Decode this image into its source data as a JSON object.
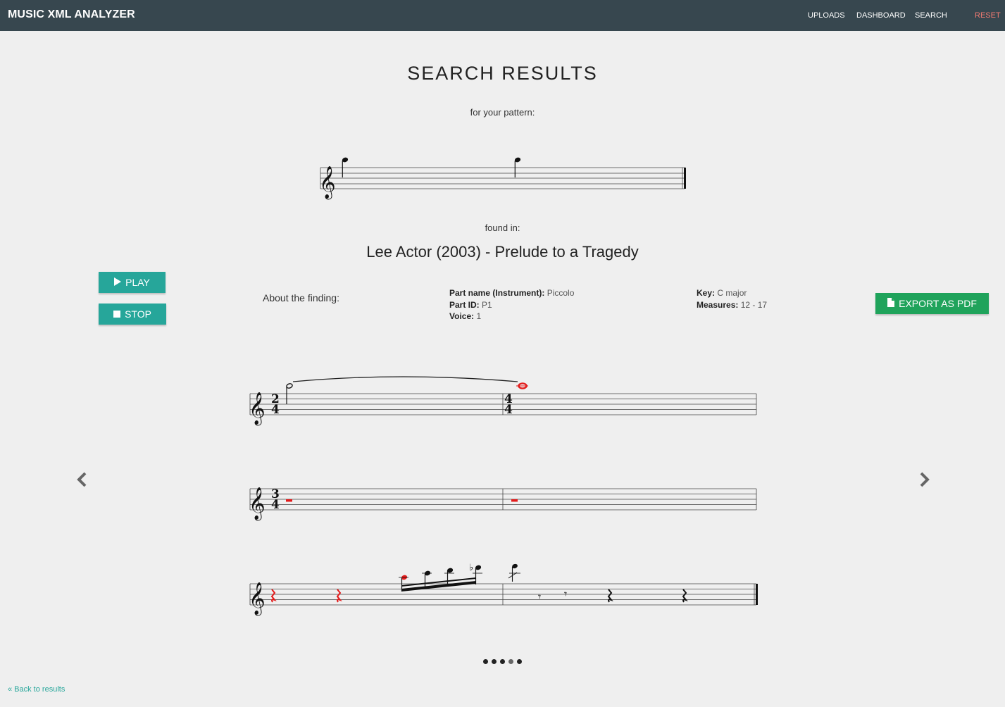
{
  "app": {
    "brand": "MUSIC XML ANALYZER"
  },
  "nav": {
    "uploads": "UPLOADS",
    "dashboard": "DASHBOARD",
    "search": "SEARCH",
    "reset": "RESET"
  },
  "page": {
    "title": "SEARCH RESULTS",
    "pattern_label": "for your pattern:",
    "found_in_label": "found in:",
    "piece_title": "Lee Actor (2003) - Prelude to a Tragedy"
  },
  "controls": {
    "play_label": "PLAY",
    "stop_label": "STOP",
    "export_label": "EXPORT AS PDF"
  },
  "about": {
    "label": "About the finding:",
    "part_name_key": "Part name (Instrument):",
    "part_name_value": "Piccolo",
    "part_id_key": "Part ID:",
    "part_id_value": "P1",
    "voice_key": "Voice:",
    "voice_value": "1",
    "key_key": "Key:",
    "key_value": "C major",
    "measures_key": "Measures:",
    "measures_value": "12 - 17"
  },
  "score": {
    "system1_time_sigs": [
      [
        "2",
        "4"
      ],
      [
        "4",
        "4"
      ]
    ],
    "system2_time_sig": [
      "3",
      "4"
    ],
    "highlight_color": "#e31b1b"
  },
  "carousel": {
    "slide_count": 5,
    "active_index": 3
  },
  "footer": {
    "back_link": "« Back to results"
  },
  "colors": {
    "navbar": "#37474f",
    "teal": "#26a69a",
    "green": "#1fa35b",
    "reset": "#ef7a72"
  }
}
